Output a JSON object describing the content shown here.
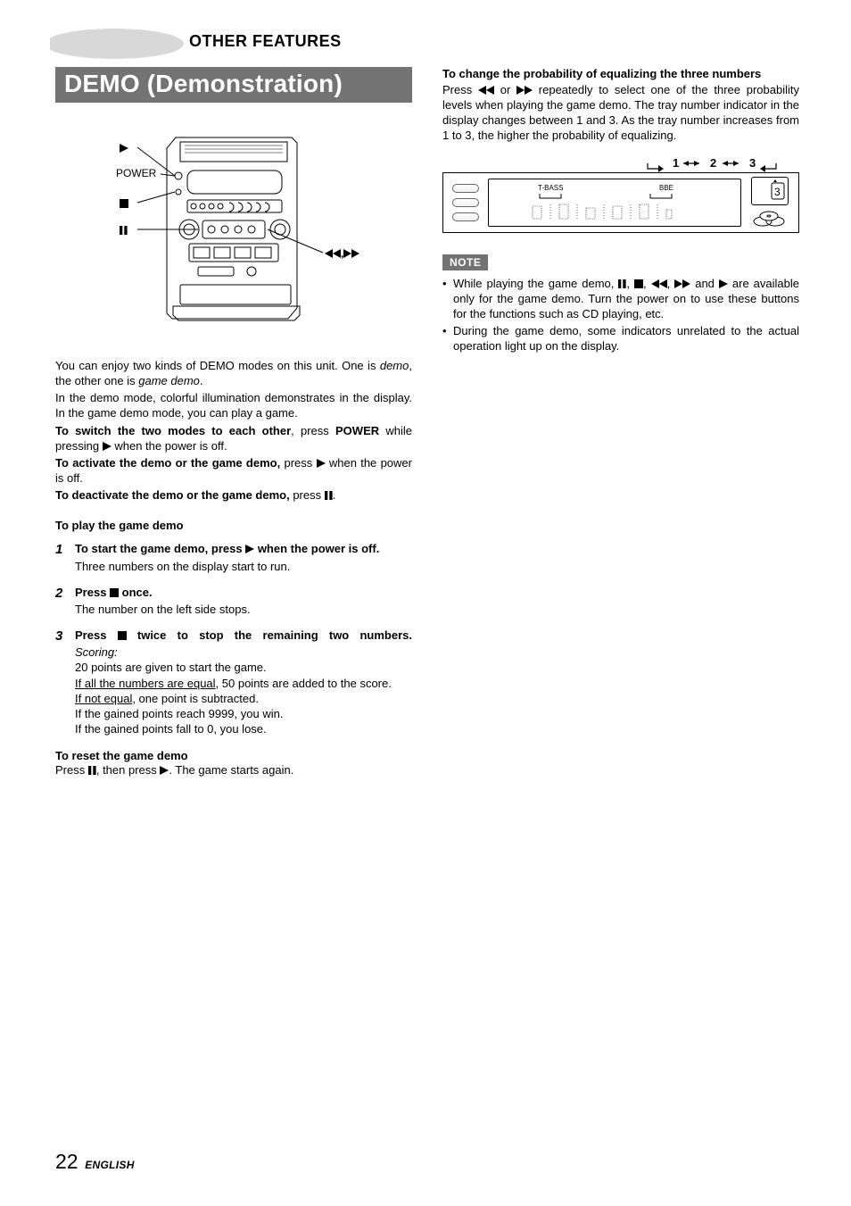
{
  "chapter": "OTHER FEATURES",
  "section_title": "DEMO (Demonstration)",
  "figure": {
    "callouts": {
      "play": "c",
      "power": "POWER",
      "stop": "s",
      "pause": "a",
      "seek": "f,g"
    }
  },
  "intro": {
    "p1a": "You can enjoy two kinds of DEMO modes on this unit. One is ",
    "p1b": "demo",
    "p1c": ", the other one is ",
    "p1d": "game demo",
    "p1e": ".",
    "p2": "In the demo mode, colorful illumination demonstrates in the display. In the game demo mode, you can play a game.",
    "p3a": "To switch the two modes to each other",
    "p3b": ", press ",
    "p3c": "POWER",
    "p3d": " while pressing ",
    "p3e": " when the power is off.",
    "p4a": "To activate the demo or the game demo,",
    "p4b": " press ",
    "p4c": " when the power is off.",
    "p5a": "To deactivate the demo or the game demo,",
    "p5b": " press ",
    "p5c": "."
  },
  "play_head": "To play the game demo",
  "steps": [
    {
      "head_a": "To start the game demo, press ",
      "head_b": " when the power is off.",
      "body": "Three numbers on the display start to run."
    },
    {
      "head_a": "Press ",
      "head_b": " once.",
      "body": "The number on the left side stops."
    },
    {
      "head_a": "Press ",
      "head_b": " twice to stop the remaining two numbers.",
      "body_scoring_label": "Scoring:",
      "body_lines": [
        "20 points are given to start the game.",
        {
          "u": "If all the numbers are equal",
          "rest": ", 50 points are added to the score."
        },
        {
          "u": "If not equal",
          "rest": ", one point is subtracted."
        },
        "If the gained points reach 9999, you win.",
        "If the gained points fall to 0, you lose."
      ]
    }
  ],
  "reset": {
    "head": "To reset the game demo",
    "body_a": "Press ",
    "body_b": ", then press ",
    "body_c": ". The game starts again."
  },
  "right": {
    "head": "To change the probability of equalizing the three numbers",
    "p_a": "Press ",
    "p_b": " or ",
    "p_c": " repeatedly to select one of the three probability levels when playing the game demo. The tray number indicator in the display changes between 1 and 3. As the tray number increases from 1 to 3, the higher the probability of equalizing.",
    "cycle": "1 ↔ 2 ↔ 3",
    "panel": {
      "tbass": "T-BASS",
      "bbe": "BBE"
    }
  },
  "note_label": "NOTE",
  "notes": {
    "n1_a": "While playing the game demo, ",
    "n1_b": " and ",
    "n1_c": " are available only for the game demo. Turn the power on to use these buttons for the functions such as CD playing, etc.",
    "n2": "During the game demo, some indicators unrelated to the actual operation light up on the display."
  },
  "footer": {
    "page": "22",
    "lang": "ENGLISH"
  }
}
